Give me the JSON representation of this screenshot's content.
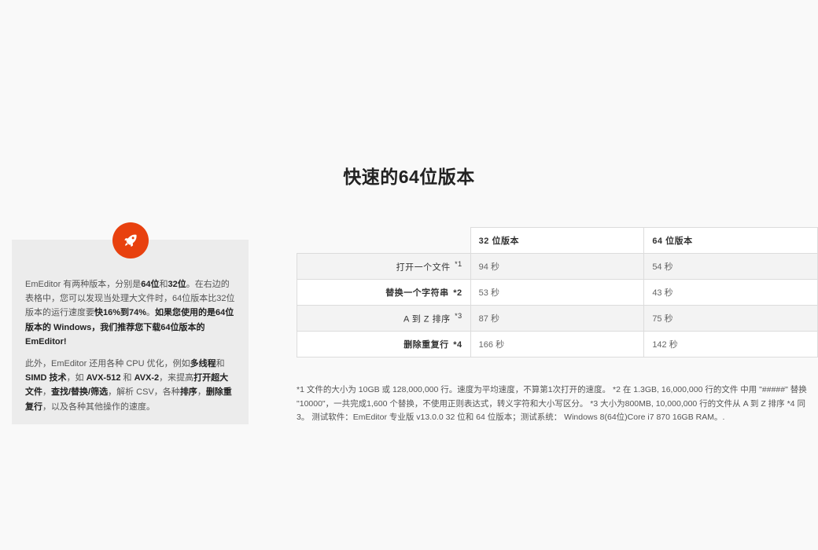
{
  "title": "快速的64位版本",
  "info": {
    "p1": [
      {
        "text": "EmEditor 有两种版本，分别是",
        "bold": false
      },
      {
        "text": "64位",
        "bold": true
      },
      {
        "text": "和",
        "bold": false
      },
      {
        "text": "32位",
        "bold": true
      },
      {
        "text": "。在右边的表格中，您可以发现当处理大文件时，64位版本比32位版本的运行速度要",
        "bold": false
      },
      {
        "text": "快16%到74%",
        "bold": true
      },
      {
        "text": "。",
        "bold": false
      },
      {
        "text": "如果您使用的是64位版本的 Windows，我们推荐您下载64位版本的 EmEditor!",
        "bold": true
      }
    ],
    "p2": [
      {
        "text": "此外，EmEditor 还用各种 CPU 优化，例如",
        "bold": false
      },
      {
        "text": "多线程",
        "bold": true
      },
      {
        "text": "和 ",
        "bold": false
      },
      {
        "text": "SIMD 技术",
        "bold": true
      },
      {
        "text": "，如 ",
        "bold": false
      },
      {
        "text": "AVX-512",
        "bold": true
      },
      {
        "text": " 和 ",
        "bold": false
      },
      {
        "text": "AVX-2",
        "bold": true
      },
      {
        "text": "，来提高",
        "bold": false
      },
      {
        "text": "打开超大文件",
        "bold": true
      },
      {
        "text": "，",
        "bold": false
      },
      {
        "text": "查找/替换/筛选",
        "bold": true
      },
      {
        "text": "，解析 CSV，各种",
        "bold": false
      },
      {
        "text": "排序",
        "bold": true
      },
      {
        "text": "，",
        "bold": false
      },
      {
        "text": "删除重复行",
        "bold": true
      },
      {
        "text": "，以及各种其他操作的速度。",
        "bold": false
      }
    ]
  },
  "table": {
    "headers": [
      "32 位版本",
      "64 位版本"
    ],
    "rows": [
      {
        "label": "打开一个文件",
        "note": "*1",
        "v32": "94 秒",
        "v64": "54 秒",
        "bold": false
      },
      {
        "label": "替换一个字符串",
        "note": "*2",
        "v32": "53 秒",
        "v64": "43 秒",
        "bold": true
      },
      {
        "label": "A 到 Z 排序",
        "note": "*3",
        "v32": "87 秒",
        "v64": "75 秒",
        "bold": false
      },
      {
        "label": "删除重复行",
        "note": "*4",
        "v32": "166 秒",
        "v64": "142 秒",
        "bold": true
      }
    ]
  },
  "footnotes": "*1 文件的大小为 10GB 或 128,000,000 行。速度为平均速度，不算第1次打开的速度。 *2 在 1.3GB, 16,000,000 行的文件 中用 \"#####\" 替换 \"10000\"，一共完成1,600 个替换，不使用正则表达式，转义字符和大小写区分。 *3 大小为800MB, 10,000,000 行的文件从 A 到 Z 排序 *4 同 3。 测试软件：EmEditor 专业版 v13.0.0 32 位和 64 位版本；测试系统： Windows 8(64位)Core i7 870 16GB RAM。.",
  "colors": {
    "accent": "#e8410f",
    "card_bg": "#ececec",
    "page_bg": "#f9f9f9"
  },
  "icons": {
    "badge": "rocket-icon"
  }
}
